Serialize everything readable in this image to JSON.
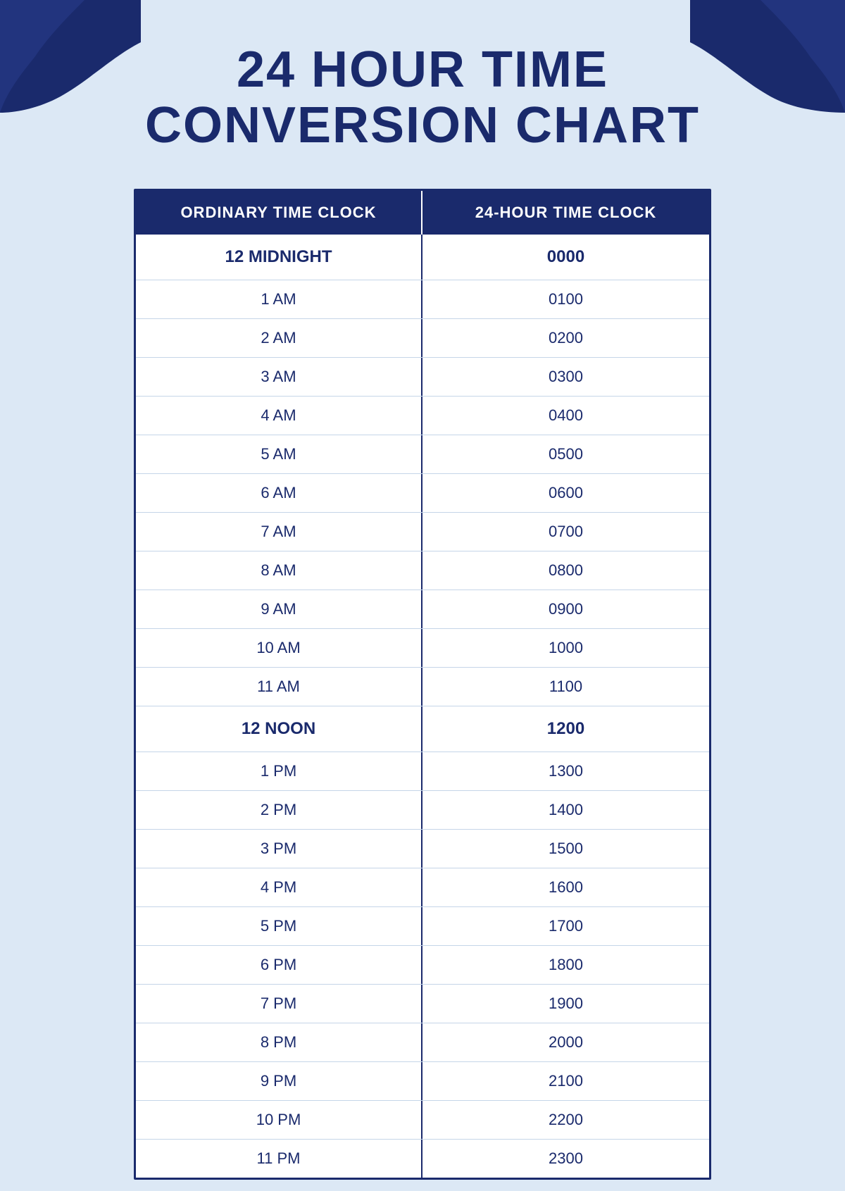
{
  "page": {
    "background_color": "#dce8f5",
    "title_line1": "24 HOUR TIME",
    "title_line2": "CONVERSION CHART"
  },
  "table": {
    "header": {
      "col1": "ORDINARY TIME CLOCK",
      "col2": "24-HOUR TIME CLOCK"
    },
    "rows": [
      {
        "ordinary": "12 MIDNIGHT",
        "military": "0000",
        "special": true
      },
      {
        "ordinary": "1 AM",
        "military": "0100",
        "special": false
      },
      {
        "ordinary": "2 AM",
        "military": "0200",
        "special": false
      },
      {
        "ordinary": "3 AM",
        "military": "0300",
        "special": false
      },
      {
        "ordinary": "4 AM",
        "military": "0400",
        "special": false
      },
      {
        "ordinary": "5 AM",
        "military": "0500",
        "special": false
      },
      {
        "ordinary": "6 AM",
        "military": "0600",
        "special": false
      },
      {
        "ordinary": "7 AM",
        "military": "0700",
        "special": false
      },
      {
        "ordinary": "8 AM",
        "military": "0800",
        "special": false
      },
      {
        "ordinary": "9 AM",
        "military": "0900",
        "special": false
      },
      {
        "ordinary": "10 AM",
        "military": "1000",
        "special": false
      },
      {
        "ordinary": "11 AM",
        "military": "1100",
        "special": false
      },
      {
        "ordinary": "12 NOON",
        "military": "1200",
        "special": true
      },
      {
        "ordinary": "1 PM",
        "military": "1300",
        "special": false
      },
      {
        "ordinary": "2 PM",
        "military": "1400",
        "special": false
      },
      {
        "ordinary": "3 PM",
        "military": "1500",
        "special": false
      },
      {
        "ordinary": "4 PM",
        "military": "1600",
        "special": false
      },
      {
        "ordinary": "5 PM",
        "military": "1700",
        "special": false
      },
      {
        "ordinary": "6 PM",
        "military": "1800",
        "special": false
      },
      {
        "ordinary": "7 PM",
        "military": "1900",
        "special": false
      },
      {
        "ordinary": "8 PM",
        "military": "2000",
        "special": false
      },
      {
        "ordinary": "9 PM",
        "military": "2100",
        "special": false
      },
      {
        "ordinary": "10 PM",
        "military": "2200",
        "special": false
      },
      {
        "ordinary": "11 PM",
        "military": "2300",
        "special": false
      }
    ]
  }
}
